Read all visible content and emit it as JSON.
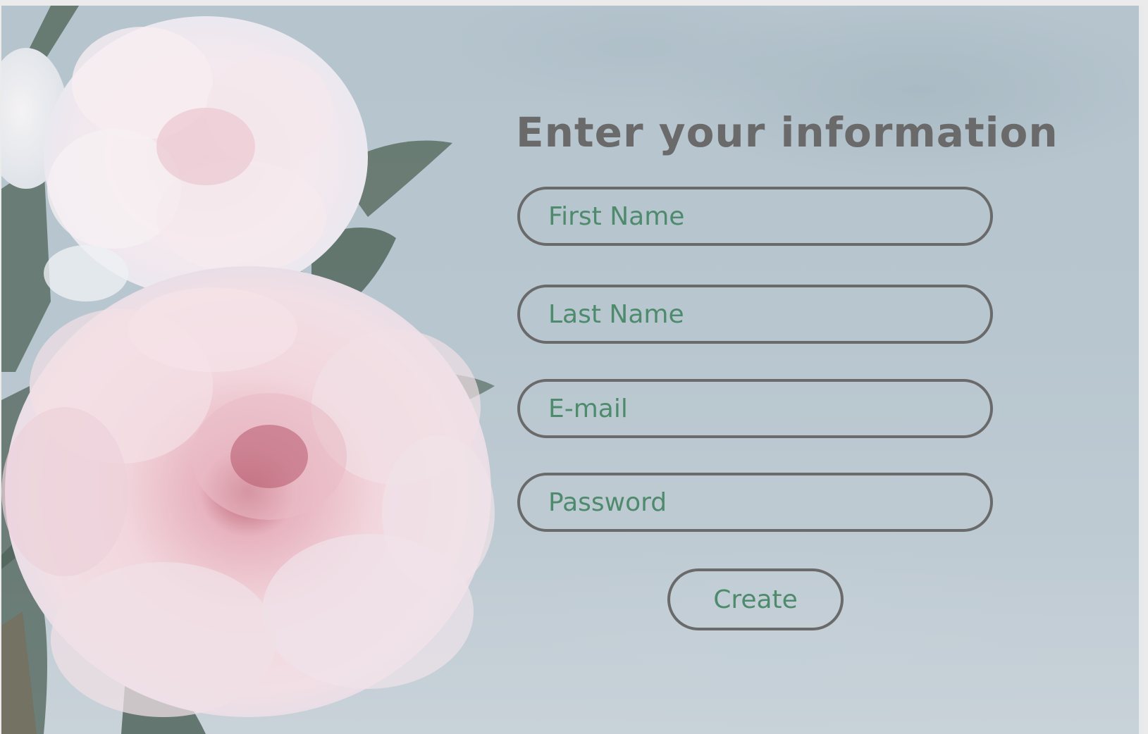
{
  "form": {
    "title": "Enter your information",
    "fields": [
      {
        "placeholder": "First Name",
        "value": ""
      },
      {
        "placeholder": "Last Name",
        "value": ""
      },
      {
        "placeholder": "E-mail",
        "value": ""
      },
      {
        "placeholder": "Password",
        "value": ""
      }
    ],
    "submit_label": "Create"
  },
  "colors": {
    "title_text": "#6a6a6a",
    "field_border": "#6a6a6a",
    "placeholder_text": "#4e8a6c",
    "background": "#b8c6cf",
    "flower_petal": "#f3dfe4"
  },
  "images": {
    "background_photo": "pink peony flowers"
  }
}
